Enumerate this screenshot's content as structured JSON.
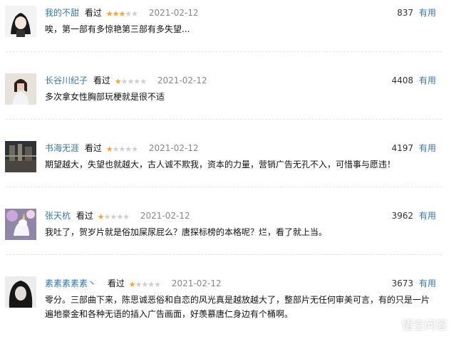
{
  "reviews": [
    {
      "name": "我的不甜",
      "seen": "看过",
      "rating": 3,
      "date": "2021-02-12",
      "votes": "837",
      "useful": "有用",
      "text": "唉，第一部有多惊艳第三部有多失望..."
    },
    {
      "name": "长谷川纪子",
      "seen": "看过",
      "rating": 1,
      "date": "2021-02-12",
      "votes": "4408",
      "useful": "有用",
      "text": "多次拿女性胸部玩梗就是很不适"
    },
    {
      "name": "书海无涯",
      "seen": "看过",
      "rating": 1,
      "date": "2021-02-12",
      "votes": "4197",
      "useful": "有用",
      "text": "期望越大，失望也就越大，古人诚不欺我，资本的力量，营销广告无孔不入，可惜事与愿违！"
    },
    {
      "name": "张天杭",
      "seen": "看过",
      "rating": 1,
      "date": "2021-02-12",
      "votes": "3962",
      "useful": "有用",
      "text": "我吐了，贺岁片就是俗加屎尿屁么？唐探标榜的本格呢？烂，看了就上当。"
    },
    {
      "name": "素素素素素丶",
      "seen": "看过",
      "rating": 1,
      "date": "2021-02-12",
      "votes": "3673",
      "useful": "有用",
      "text": "零分。三部曲下来，陈思诚恶俗和自恋的风光真是越放越大了，整部片无任何审美可言，有的只是一片遍地豪金和各种无语的插入广告画面，好羡慕唐仁身边有个桶啊。"
    }
  ],
  "watermark": "悟空问答",
  "colors": {
    "link": "#3377aa",
    "star_on": "#f7a427",
    "star_off": "#cfcfcf",
    "date": "#888888"
  }
}
